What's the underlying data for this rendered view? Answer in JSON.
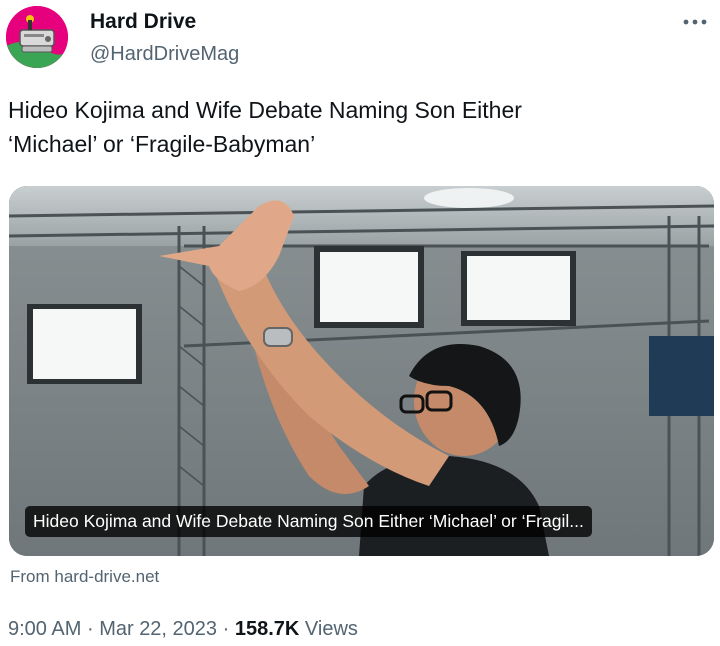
{
  "author": {
    "display_name": "Hard Drive",
    "handle": "@HardDriveMag",
    "avatar_icon": "hard-drive-logo-avatar"
  },
  "more_icon": "more-dots-icon",
  "tweet": {
    "line1": "Hideo Kojima and Wife Debate Naming Son Either",
    "line2": "‘Michael’ or ‘Fragile-Babyman’"
  },
  "link_card": {
    "title": "Hideo Kojima and Wife Debate Naming Son Either ‘Michael’ or ‘Fragil...",
    "source": "From hard-drive.net"
  },
  "meta": {
    "time": "9:00 AM",
    "separator1": "·",
    "date": "Mar 22, 2023",
    "separator2": "·",
    "views_count": "158.7K",
    "views_label": "Views"
  },
  "colors": {
    "text_primary": "#0f1419",
    "text_secondary": "#536471",
    "avatar_bg": "#e6007e"
  }
}
